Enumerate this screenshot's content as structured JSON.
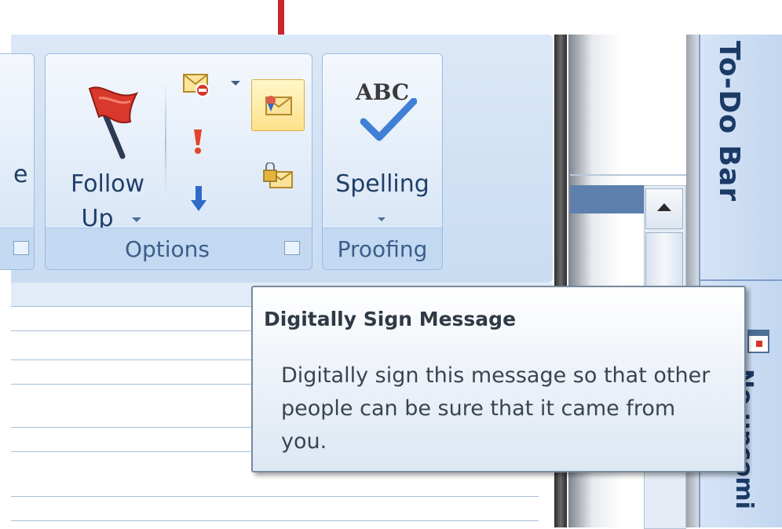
{
  "ribbon": {
    "partial_group_label_fragment": "e",
    "options_group": {
      "label": "Options",
      "follow_up": {
        "line1": "Follow",
        "line2": "Up"
      },
      "icons": [
        "follow-up-flag-icon",
        "permission-icon",
        "high-importance-icon",
        "low-importance-icon",
        "digitally-sign-icon",
        "encrypt-message-icon"
      ]
    },
    "proofing_group": {
      "label": "Proofing",
      "spelling": {
        "label": "Spelling",
        "icon_text": "ABC"
      }
    }
  },
  "todo_bar": {
    "title": "To-Do Bar",
    "subtitle": "No upcomi"
  },
  "tooltip": {
    "title": "Digitally Sign Message",
    "body": "Digitally sign this message so that other people can be sure that it came from you."
  },
  "colors": {
    "annotation_arrow": "#c8262a",
    "highlight": "#fde79a",
    "ribbon_bg": "#dbe8f7",
    "group_label": "#3b5e8a"
  }
}
